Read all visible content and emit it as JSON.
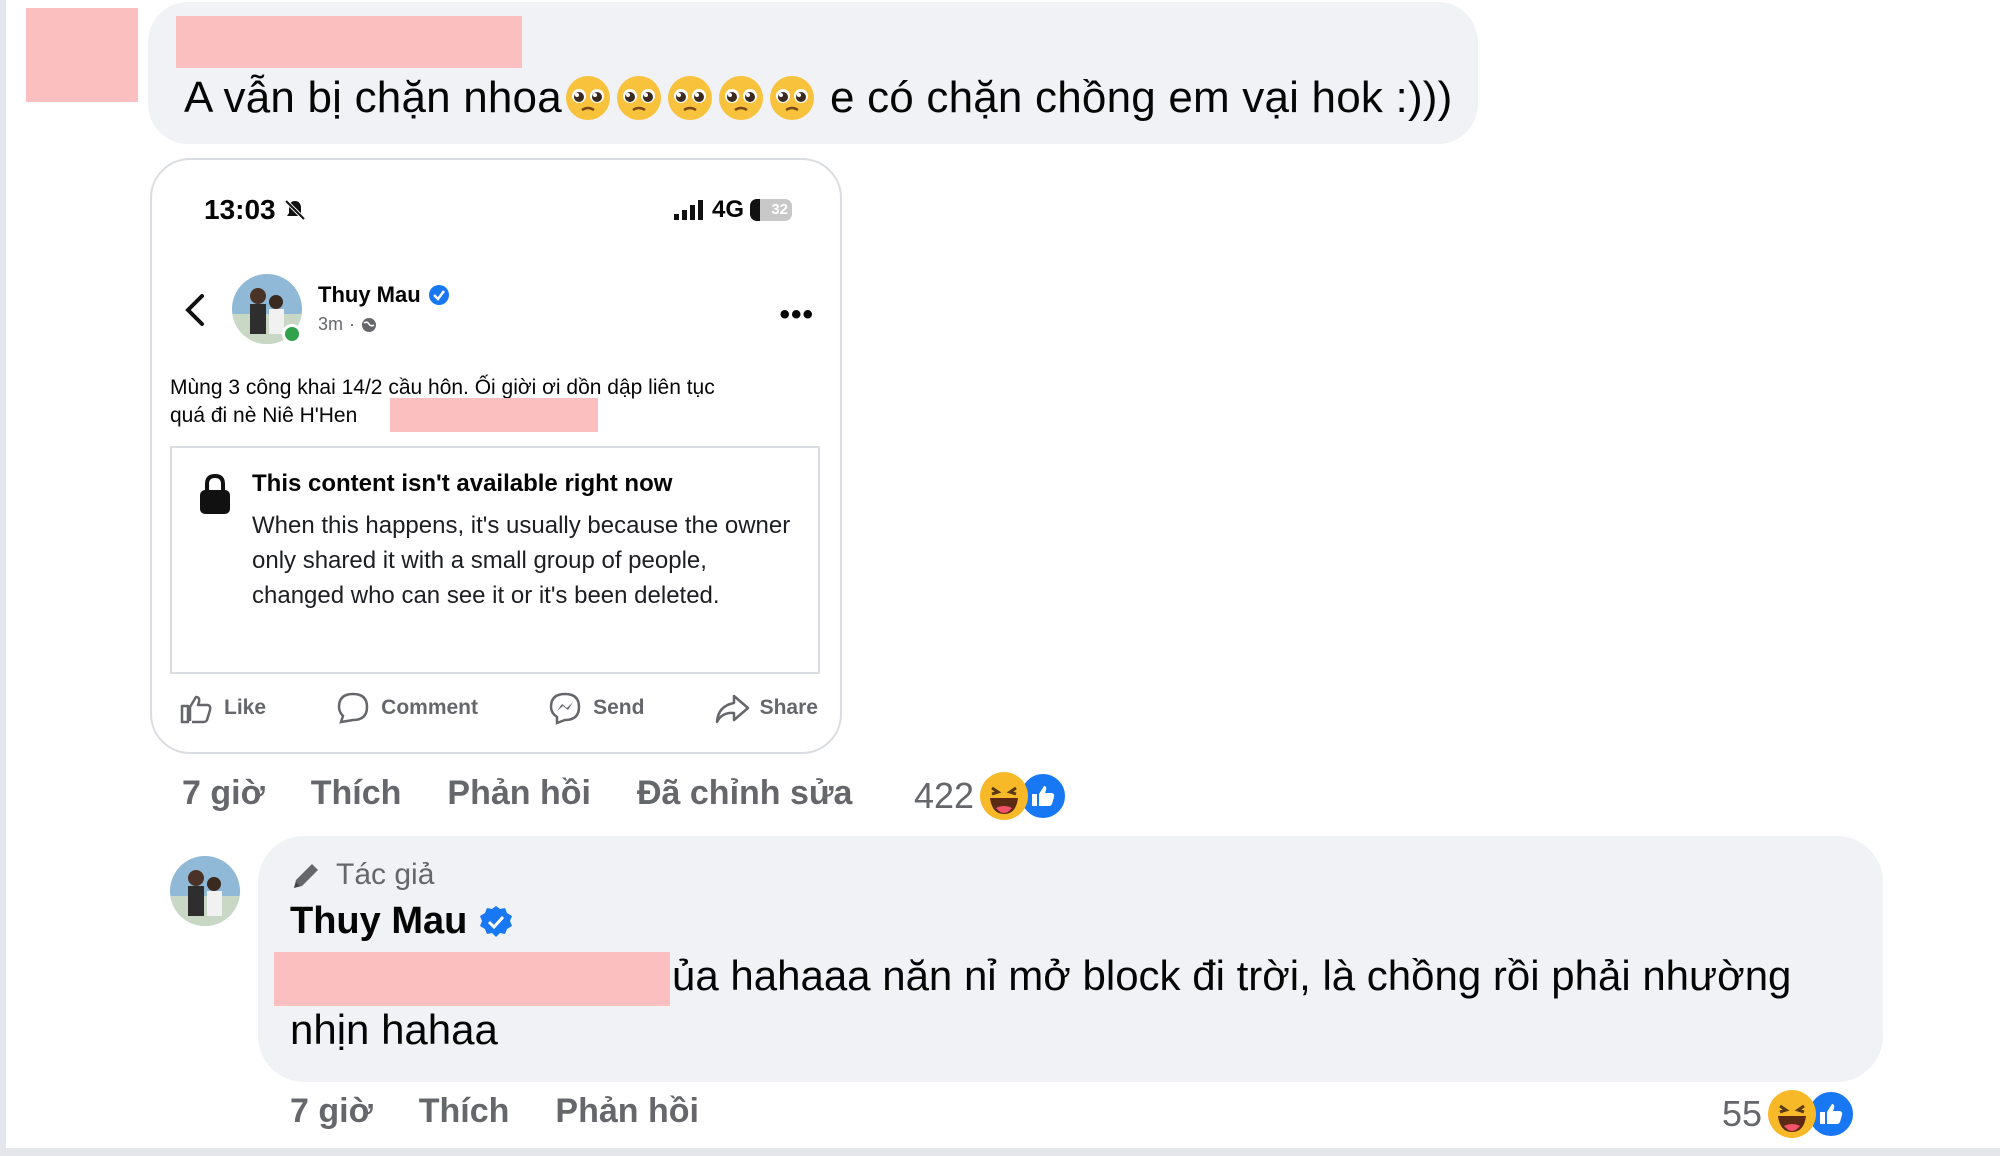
{
  "comment": {
    "text_before_emojis": "A vẫn bị chặn nhoa",
    "emojis": [
      "pleading-face",
      "pleading-face",
      "pleading-face",
      "pleading-face",
      "pleading-face"
    ],
    "text_after_emojis": "e có chặn chồng em vại hok :)))",
    "meta": {
      "time": "7 giờ",
      "like": "Thích",
      "reply": "Phản hồi",
      "edited": "Đã chỉnh sửa"
    },
    "reaction_count": "422"
  },
  "screenshot": {
    "status_time": "13:03",
    "network": "4G",
    "battery": "32",
    "poster_name": "Thuy Mau",
    "post_time": "3m",
    "post_text_line1": "Mùng 3 công khai 14/2 cầu hôn.  Ối giời ơi dồn dập liên tục",
    "post_text_line2": "quá đi nè Niê H'Hen",
    "unavailable_title": "This content isn't available right now",
    "unavailable_body": "When this happens, it's usually because the owner only shared it with a small group of people, changed who can see it or it's been deleted.",
    "actions": {
      "like": "Like",
      "comment": "Comment",
      "send": "Send",
      "share": "Share"
    }
  },
  "reply": {
    "author_tag": "Tác giả",
    "name": "Thuy Mau",
    "text_line1": "ủa hahaaa năn nỉ mở block đi trời, là chồng rồi phải nhường",
    "text_line2": "nhịn hahaa",
    "meta": {
      "time": "7 giờ",
      "like": "Thích",
      "reply": "Phản hồi"
    },
    "reaction_count": "55"
  },
  "colors": {
    "bubble": "#f0f2f5",
    "meta_text": "#65676b",
    "facebook_blue": "#1877f2",
    "redaction": "#fbbfbf",
    "online_green": "#31a24c"
  }
}
